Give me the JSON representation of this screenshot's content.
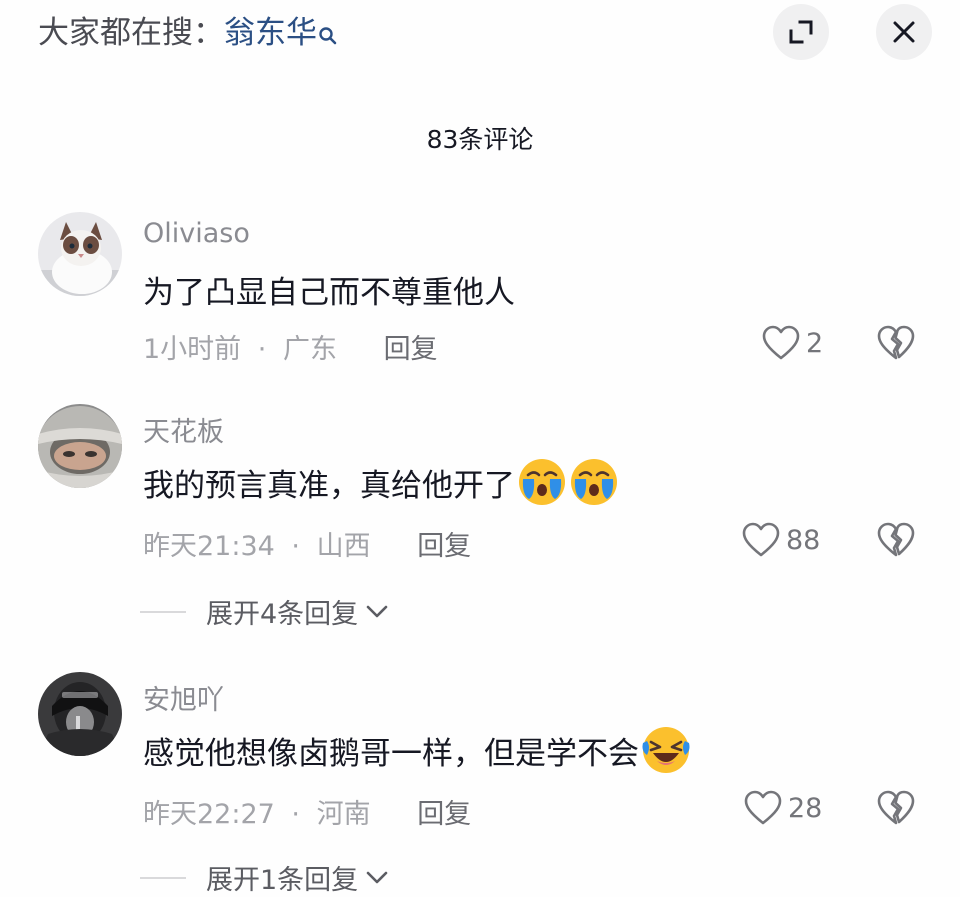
{
  "header": {
    "hot_search_prefix": "大家都在搜：",
    "hot_search_keyword": "翁东华",
    "hot_search_icon": "search-icon",
    "expand_icon": "expand-icon",
    "close_icon": "close-icon"
  },
  "comment_count": "83条评论",
  "comments": [
    {
      "username": "Oliviaso",
      "text": "为了凸显自己而不尊重他人",
      "time": "1小时前",
      "location": "广东",
      "reply_label": "回复",
      "likes": "2",
      "emojis": []
    },
    {
      "username": "天花板",
      "text": "我的预言真准，真给他开了",
      "time": "昨天21:34",
      "location": "山西",
      "reply_label": "回复",
      "likes": "88",
      "emojis": [
        "crying-emoji",
        "crying-emoji"
      ],
      "expand_replies": "展开4条回复"
    },
    {
      "username": "安旭吖",
      "text": "感觉他想像卤鹅哥一样，但是学不会",
      "time": "昨天22:27",
      "location": "河南",
      "reply_label": "回复",
      "likes": "28",
      "emojis": [
        "laughing-crying-emoji"
      ],
      "expand_replies": "展开1条回复"
    }
  ],
  "meta_separator": "·",
  "colors": {
    "background": "#fefefe",
    "keyword": "#2b4f84",
    "username": "#8a8b91",
    "meta": "#a3a4a9",
    "emoji_yellow": "#fbc02d",
    "tear_blue": "#2f8fe8"
  }
}
